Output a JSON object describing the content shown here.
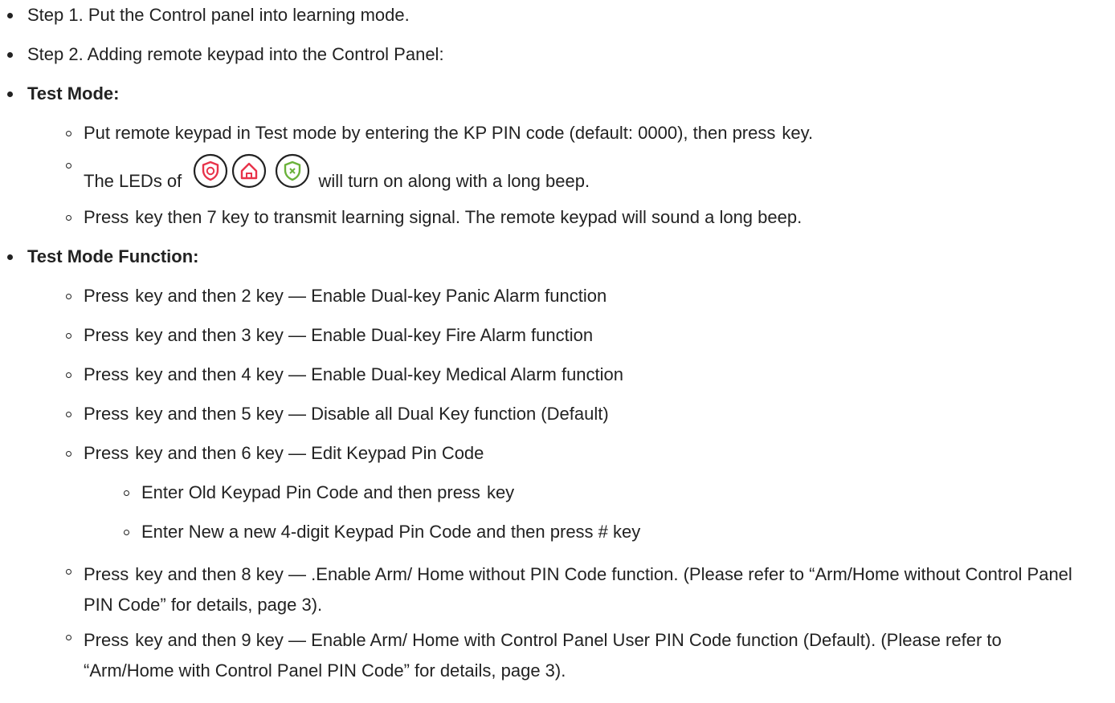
{
  "step1": "Step 1. Put the Control panel into learning mode.",
  "step2": "Step 2. Adding remote keypad into the Control Panel:",
  "test_mode": {
    "heading": "Test Mode:",
    "item1": "Put remote keypad in Test mode by entering the KP PIN code (default: 0000), then press",
    "item1_end": "key.",
    "item2_pre": "The LEDs of",
    "item2_post": "will turn on along with a long beep.",
    "item3_pre": "Press",
    "item3_post": "key then 7 key to transmit learning signal. The remote keypad will sound a long beep."
  },
  "icons": [
    {
      "name": "away-arm-shield-icon",
      "color": "#e8334a"
    },
    {
      "name": "home-arm-house-icon",
      "color": "#e8334a"
    },
    {
      "name": "disarm-shield-x-icon",
      "color": "#6ab23a"
    }
  ],
  "function": {
    "heading": "Test Mode Function:",
    "press": "Press",
    "items": [
      "key and then 2 key — Enable Dual-key Panic Alarm function",
      "key and then 3 key — Enable Dual-key Fire Alarm function",
      "key and then 4 key — Enable Dual-key Medical Alarm function",
      "key and then 5 key — Disable all Dual Key function (Default)",
      "key and then 6 key — Edit Keypad Pin Code"
    ],
    "sub": {
      "a_pre": "Enter Old Keypad Pin Code and then press",
      "a_post": "key",
      "b": "Enter New a new 4-digit Keypad Pin Code and then press # key"
    },
    "item8": "key and then 8 key — .Enable Arm/ Home without PIN Code function. (Please refer to “Arm/Home without Control Panel PIN Code” for details, page 3).",
    "item9": "key and then 9 key — Enable Arm/ Home with Control Panel User PIN Code function (Default). (Please refer to “Arm/Home with Control Panel PIN Code” for details, page 3)."
  }
}
